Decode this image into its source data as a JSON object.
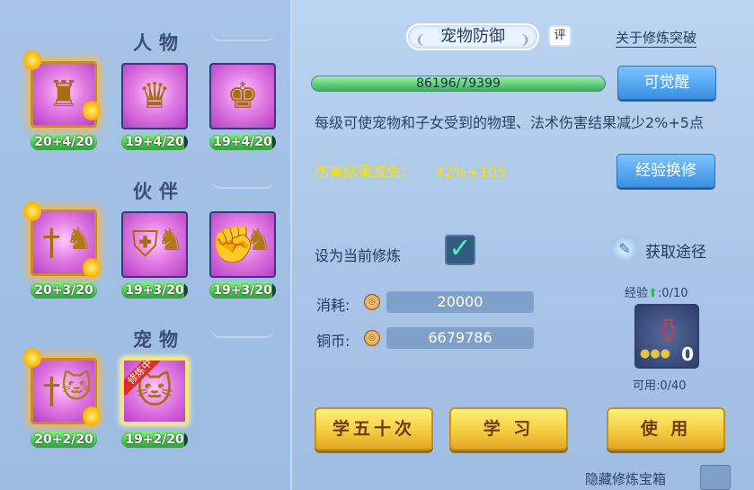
{
  "sections": [
    {
      "title": "人物",
      "slots": [
        {
          "icon": "golden-warrior-icon",
          "level": "20+4/20",
          "fill": 1.0,
          "flaming": true
        },
        {
          "icon": "golden-armor-icon",
          "level": "19+4/20",
          "fill": 0.95
        },
        {
          "icon": "golden-guardian-icon",
          "level": "19+4/20",
          "fill": 0.95
        }
      ]
    },
    {
      "title": "伙伴",
      "slots": [
        {
          "icon": "sword-lion-icon",
          "level": "20+3/20",
          "fill": 1.0,
          "flaming": true
        },
        {
          "icon": "shield-lion-icon",
          "level": "19+3/20",
          "fill": 0.95
        },
        {
          "icon": "fist-lion-icon",
          "level": "19+3/20",
          "fill": 0.95
        }
      ]
    },
    {
      "title": "宠物",
      "slots": [
        {
          "icon": "sword-cat-icon",
          "level": "20+2/20",
          "fill": 1.0,
          "flaming": true
        },
        {
          "icon": "pet-cat-icon",
          "level": "19+2/20",
          "fill": 0.95,
          "ribbon": "修炼中",
          "selected": true
        }
      ]
    }
  ],
  "detail": {
    "title": "宠物防御",
    "rate_badge": "评",
    "about_link": "关于修炼突破",
    "progress_text": "86196/79399",
    "progress_fill": 1.0,
    "awaken_button": "可觉醒",
    "description": "每级可使宠物和子女受到的物理、法术伤害结果减少2%+5点",
    "reduction_label": "伤害结果减免：",
    "reduction_value": "42%+105",
    "exchange_button": "经验换修",
    "set_current_label": "设为当前修炼",
    "set_current_checked": true,
    "get_path_label": "获取途径",
    "cost_label": "消耗:",
    "cost_value": "20000",
    "coins_label": "铜币:",
    "coins_value": "6679786",
    "exp_label": "经验",
    "exp_value": ":0/10",
    "item_count": "0",
    "available_text": "可用:0/40",
    "learn50_button": "学五十次",
    "learn_button": "学 习",
    "use_button": "使 用",
    "hidden_chest_label": "隐藏修炼宝箱"
  },
  "colors": {
    "reduction_text": "#f6e300",
    "bar_green": "#3ab05a",
    "gold_button": "#f4c93c",
    "blue_button": "#3a8fe2"
  }
}
